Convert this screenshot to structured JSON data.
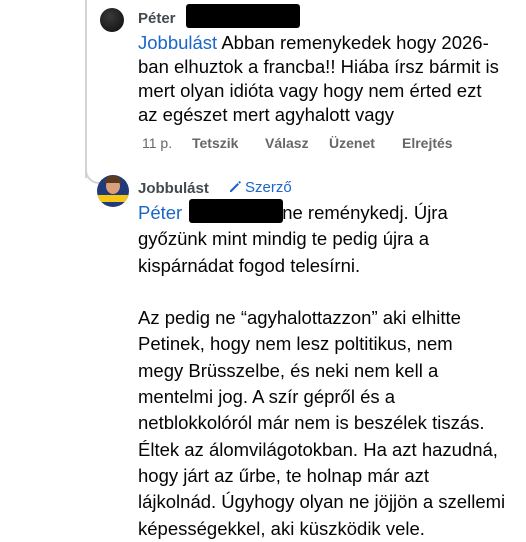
{
  "comment1": {
    "author": "Péter",
    "text_lines": [
      "Abban remenykedek hogy 2026-",
      "ban elhuztok a francba!! Hiába írsz bármit is",
      "mert olyan idióta vagy hogy nem érted ezt",
      "az egészet mert agyhalott vagy"
    ],
    "mention": "Jobbulást",
    "time": "11 p.",
    "actions": [
      "Tetszik",
      "Válasz",
      "Üzenet",
      "Elrejtés"
    ]
  },
  "reply": {
    "author": "Jobbulást",
    "badge": "Szerző",
    "mention": "Péter",
    "text_lines": [
      "ne reménykedj. Újra",
      "győzünk mint mindig te pedig újra a",
      "kispárnádat fogod telesírni.",
      "",
      "Az pedig ne “agyhalottazzon” aki elhitte",
      "Petinek, hogy nem lesz poltitikus, nem",
      "megy Brüsszelbe, és neki nem kell a",
      "mentelmi jog. A szír gépről és a",
      "netblokkolóról már nem is beszélek tiszás.",
      "Éltek az álomvilágotokban. Ha azt hazudná,",
      "hogy járt az űrbe, te holnap már azt",
      "lájkolnád. Úgyhogy olyan ne jöjjön a szellemi",
      "képességekkel, aki küszködik vele."
    ]
  },
  "colors": {
    "link_blue": "#1a66c9",
    "meta_gray": "#65676b",
    "text": "#050505"
  }
}
